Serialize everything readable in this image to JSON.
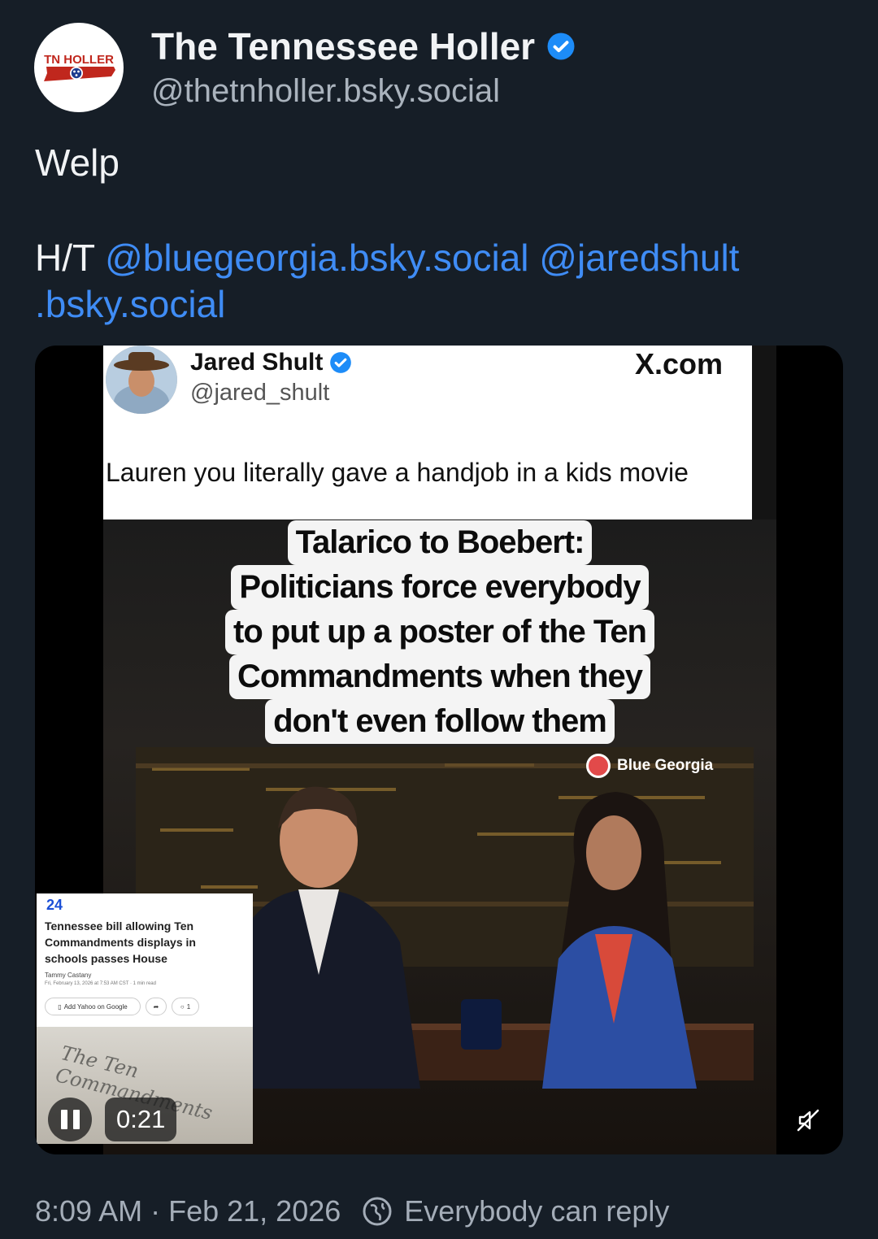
{
  "author": {
    "display_name": "The Tennessee Holler",
    "handle": "@thetnholler.bsky.social",
    "avatar_text": "TN HOLLER",
    "verified": true
  },
  "post": {
    "line1": "Welp",
    "ht_prefix": "H/T",
    "mention1": "@bluegeorgia.bsky.social",
    "mention2_a": "@jaredshult",
    "mention2_b": ".bsky.social"
  },
  "video": {
    "quote": {
      "name": "Jared Shult",
      "handle": "@jared_shult",
      "source": "X.com",
      "text": "Lauren you literally gave a handjob in a kids movie"
    },
    "caption_lines": [
      "Talarico to Boebert:",
      "Politicians force everybody",
      "to put up a poster of the Ten",
      "Commandments when they",
      "don't even follow them"
    ],
    "watermark": "Blue Georgia",
    "news_card": {
      "logo": "24",
      "title": "Tennessee bill allowing Ten Commandments displays in schools passes House",
      "author": "Tammy Castany",
      "date": "Fri, February 13, 2026 at 7:53 AM CST · 1 min read",
      "button_google": "Add Yahoo on Google",
      "comments": "1",
      "image_text": "The Ten Commandments"
    },
    "elapsed": "0:21",
    "icons": {
      "pause": "pause-icon",
      "mute": "muted-speaker-icon"
    }
  },
  "footer": {
    "time": "8:09 AM",
    "separator": "·",
    "date": "Feb 21, 2026",
    "reply_setting": "Everybody can reply"
  },
  "colors": {
    "background": "#161e27",
    "link": "#3f8cf5",
    "muted": "#a4adb8",
    "verified": "#1d8cf8"
  }
}
